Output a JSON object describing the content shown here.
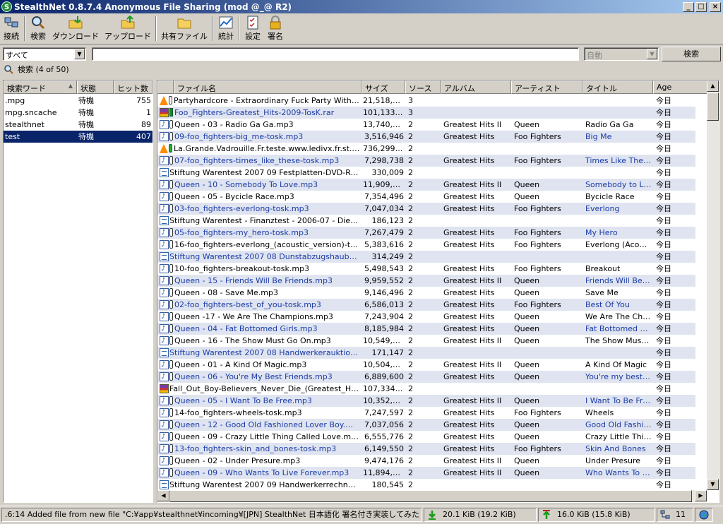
{
  "window": {
    "title": "StealthNet 0.8.7.4 Anonymous File Sharing (mod @_@ R2)",
    "controls": [
      "_",
      "□",
      "×"
    ]
  },
  "toolbar": [
    {
      "label": "接続",
      "icon": "connect-icon"
    },
    {
      "label": "検索",
      "icon": "search-icon"
    },
    {
      "label": "ダウンロード",
      "icon": "download-icon"
    },
    {
      "label": "アップロード",
      "icon": "upload-icon"
    },
    {
      "label": "共有ファイル",
      "icon": "shared-folder-icon"
    },
    {
      "label": "統計",
      "icon": "statistics-icon"
    },
    {
      "label": "設定",
      "icon": "settings-icon"
    },
    {
      "label": "署名",
      "icon": "lock-icon"
    }
  ],
  "search": {
    "type_value": "すべて",
    "query": "",
    "mode_value": "自動",
    "button_label": "検索",
    "status": "検索 (4 of 50)"
  },
  "keywords": {
    "columns": [
      "検索ワード",
      "状態",
      "ヒット数"
    ],
    "rows": [
      {
        "word": ".mpg",
        "state": "待機",
        "hits": "755"
      },
      {
        "word": "mpg.sncache",
        "state": "待機",
        "hits": "1"
      },
      {
        "word": "stealthnet",
        "state": "待機",
        "hits": "89"
      },
      {
        "word": "test",
        "state": "待機",
        "hits": "407"
      }
    ]
  },
  "results": {
    "columns": [
      "ファイル名",
      "サイズ",
      "ソース",
      "アルバム",
      "アーティスト",
      "タイトル",
      "Age"
    ],
    "rows": [
      {
        "icon": "video",
        "avail": "white",
        "name": "Partyhardcore - Extraordinary Fuck Party With A...",
        "size": "21,518,336",
        "src": "3",
        "album": "",
        "artist": "",
        "title": "",
        "age": "今日"
      },
      {
        "icon": "rar",
        "avail": "full",
        "name": "Foo_Fighters-Greatest_Hits-2009-TosK.rar",
        "size": "101,133,294",
        "src": "3",
        "album": "",
        "artist": "",
        "title": "",
        "age": "今日"
      },
      {
        "icon": "audio",
        "avail": "white",
        "name": "Queen - 03 - Radio Ga Ga.mp3",
        "size": "13,740,160",
        "src": "2",
        "album": "Greatest Hits II",
        "artist": "Queen",
        "title": "Radio Ga Ga",
        "age": "今日"
      },
      {
        "icon": "audio",
        "avail": "white",
        "name": "09-foo_fighters-big_me-tosk.mp3",
        "size": "3,516,946",
        "src": "2",
        "album": "Greatest Hits",
        "artist": "Foo Fighters",
        "title": "Big Me",
        "age": "今日"
      },
      {
        "icon": "video",
        "avail": "green",
        "name": "La.Grande.Vadrouille.Fr.teste.www.ledivx.fr.st.avi",
        "size": "736,299,290",
        "src": "2",
        "album": "",
        "artist": "",
        "title": "",
        "age": "今日"
      },
      {
        "icon": "audio",
        "avail": "white",
        "name": "07-foo_fighters-times_like_these-tosk.mp3",
        "size": "7,298,738",
        "src": "2",
        "album": "Greatest Hits",
        "artist": "Foo Fighters",
        "title": "Times Like These",
        "age": "今日"
      },
      {
        "icon": "doc",
        "avail": "",
        "name": "Stiftung Warentest 2007 09 Festplatten-DVD-Re...",
        "size": "330,009",
        "src": "2",
        "album": "",
        "artist": "",
        "title": "",
        "age": "今日"
      },
      {
        "icon": "audio",
        "avail": "white",
        "name": "Queen - 10 - Somebody To Love.mp3",
        "size": "11,909,248",
        "src": "2",
        "album": "Greatest Hits II",
        "artist": "Queen",
        "title": "Somebody to Love",
        "age": "今日"
      },
      {
        "icon": "audio",
        "avail": "white",
        "name": "Queen - 05 - Bycicle Race.mp3",
        "size": "7,354,496",
        "src": "2",
        "album": "Greatest Hits",
        "artist": "Queen",
        "title": "Bycicle Race",
        "age": "今日"
      },
      {
        "icon": "audio",
        "avail": "white",
        "name": "03-foo_fighters-everlong-tosk.mp3",
        "size": "7,047,034",
        "src": "2",
        "album": "Greatest Hits",
        "artist": "Foo Fighters",
        "title": "Everlong",
        "age": "今日"
      },
      {
        "icon": "doc",
        "avail": "",
        "name": "Stiftung Warentest - Finanztest - 2006-07 - Die ...",
        "size": "186,123",
        "src": "2",
        "album": "",
        "artist": "",
        "title": "",
        "age": "今日"
      },
      {
        "icon": "audio",
        "avail": "white",
        "name": "05-foo_fighters-my_hero-tosk.mp3",
        "size": "7,267,479",
        "src": "2",
        "album": "Greatest Hits",
        "artist": "Foo Fighters",
        "title": "My Hero",
        "age": "今日"
      },
      {
        "icon": "audio",
        "avail": "white",
        "name": "16-foo_fighters-everlong_(acoustic_version)-tosk...",
        "size": "5,383,616",
        "src": "2",
        "album": "Greatest Hits",
        "artist": "Foo Fighters",
        "title": "Everlong (Acoust...",
        "age": "今日"
      },
      {
        "icon": "doc",
        "avail": "",
        "name": "Stiftung Warentest 2007 08 Dunstabzugshauben.p...",
        "size": "314,249",
        "src": "2",
        "album": "",
        "artist": "",
        "title": "",
        "age": "今日"
      },
      {
        "icon": "audio",
        "avail": "white",
        "name": "10-foo_fighters-breakout-tosk.mp3",
        "size": "5,498,543",
        "src": "2",
        "album": "Greatest Hits",
        "artist": "Foo Fighters",
        "title": "Breakout",
        "age": "今日"
      },
      {
        "icon": "audio",
        "avail": "white",
        "name": "Queen - 15 - Friends Will Be Friends.mp3",
        "size": "9,959,552",
        "src": "2",
        "album": "Greatest Hits II",
        "artist": "Queen",
        "title": "Friends Will Be F...",
        "age": "今日"
      },
      {
        "icon": "audio",
        "avail": "white",
        "name": "Queen - 08 - Save Me.mp3",
        "size": "9,146,496",
        "src": "2",
        "album": "Greatest Hits",
        "artist": "Queen",
        "title": "Save Me",
        "age": "今日"
      },
      {
        "icon": "audio",
        "avail": "white",
        "name": "02-foo_fighters-best_of_you-tosk.mp3",
        "size": "6,586,013",
        "src": "2",
        "album": "Greatest Hits",
        "artist": "Foo Fighters",
        "title": "Best Of You",
        "age": "今日"
      },
      {
        "icon": "audio",
        "avail": "white",
        "name": "Queen -17 - We Are The Champions.mp3",
        "size": "7,243,904",
        "src": "2",
        "album": "Greatest Hits",
        "artist": "Queen",
        "title": "We Are The Cha...",
        "age": "今日"
      },
      {
        "icon": "audio",
        "avail": "white",
        "name": "Queen - 04 - Fat Bottomed Girls.mp3",
        "size": "8,185,984",
        "src": "2",
        "album": "Greatest Hits",
        "artist": "Queen",
        "title": "Fat Bottomed Gir...",
        "age": "今日"
      },
      {
        "icon": "audio",
        "avail": "white",
        "name": "Queen - 16 - The Show Must Go On.mp3",
        "size": "10,549,376",
        "src": "2",
        "album": "Greatest Hits II",
        "artist": "Queen",
        "title": "The Show Must ...",
        "age": "今日"
      },
      {
        "icon": "doc",
        "avail": "",
        "name": "Stiftung Warentest 2007 08 Handwerkerauktionen...",
        "size": "171,147",
        "src": "2",
        "album": "",
        "artist": "",
        "title": "",
        "age": "今日"
      },
      {
        "icon": "audio",
        "avail": "white",
        "name": "Queen - 01 - A Kind Of Magic.mp3",
        "size": "10,504,320",
        "src": "2",
        "album": "Greatest Hits II",
        "artist": "Queen",
        "title": "A Kind Of Magic",
        "age": "今日"
      },
      {
        "icon": "audio",
        "avail": "white",
        "name": "Queen - 06 - You're My Best Friends.mp3",
        "size": "6,889,600",
        "src": "2",
        "album": "Greatest Hits",
        "artist": "Queen",
        "title": "You're my best fr...",
        "age": "今日"
      },
      {
        "icon": "rar",
        "avail": "",
        "name": "Fall_Out_Boy-Believers_Never_Die_(Greatest_Hits...",
        "size": "107,334,755",
        "src": "2",
        "album": "",
        "artist": "",
        "title": "",
        "age": "今日"
      },
      {
        "icon": "audio",
        "avail": "white",
        "name": "Queen - 05 - I Want To Be Free.mp3",
        "size": "10,352,768",
        "src": "2",
        "album": "Greatest Hits II",
        "artist": "Queen",
        "title": "I Want To Be Free",
        "age": "今日"
      },
      {
        "icon": "audio",
        "avail": "white",
        "name": "14-foo_fighters-wheels-tosk.mp3",
        "size": "7,247,597",
        "src": "2",
        "album": "Greatest Hits",
        "artist": "Foo Fighters",
        "title": "Wheels",
        "age": "今日"
      },
      {
        "icon": "audio",
        "avail": "white",
        "name": "Queen - 12 - Good Old Fashioned Lover Boy.mp3",
        "size": "7,037,056",
        "src": "2",
        "album": "Greatest Hits",
        "artist": "Queen",
        "title": "Good Old Fashio...",
        "age": "今日"
      },
      {
        "icon": "audio",
        "avail": "white",
        "name": "Queen - 09 - Crazy Little Thing Called Love.mp3",
        "size": "6,555,776",
        "src": "2",
        "album": "Greatest Hits",
        "artist": "Queen",
        "title": "Crazy Little Thin...",
        "age": "今日"
      },
      {
        "icon": "audio",
        "avail": "white",
        "name": "13-foo_fighters-skin_and_bones-tosk.mp3",
        "size": "6,149,550",
        "src": "2",
        "album": "Greatest Hits",
        "artist": "Foo Fighters",
        "title": "Skin And Bones",
        "age": "今日"
      },
      {
        "icon": "audio",
        "avail": "white",
        "name": "Queen - 02 - Under Presure.mp3",
        "size": "9,474,176",
        "src": "2",
        "album": "Greatest Hits II",
        "artist": "Queen",
        "title": "Under Presure",
        "age": "今日"
      },
      {
        "icon": "audio",
        "avail": "white",
        "name": "Queen - 09 - Who Wants To Live Forever.mp3",
        "size": "11,894,912",
        "src": "2",
        "album": "Greatest Hits II",
        "artist": "Queen",
        "title": "Who Wants To Li...",
        "age": "今日"
      },
      {
        "icon": "doc",
        "avail": "",
        "name": "Stiftung Warentest 2007 09 Handwerkerrechnung...",
        "size": "180,545",
        "src": "2",
        "album": "",
        "artist": "",
        "title": "",
        "age": "今日"
      }
    ]
  },
  "statusbar": {
    "message": ".6:14 Added file from new file \"C:¥app¥stealthnet¥incoming¥[JPN] StealthNet 日本語化 署名付き実装してみた そ",
    "down_rate": "20.1 KiB (19.2 KiB)",
    "up_rate": "16.0 KiB (15.8 KiB)",
    "connections": "11"
  },
  "colors": {
    "selection": "#0a246a",
    "alt_row": "#dfe4f0",
    "link_blue": "#1a3ba8"
  }
}
